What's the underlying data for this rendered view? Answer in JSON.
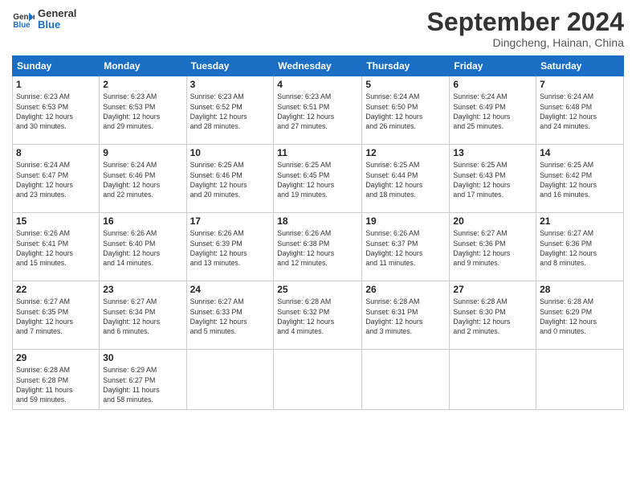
{
  "logo": {
    "line1": "General",
    "line2": "Blue"
  },
  "title": "September 2024",
  "location": "Dingcheng, Hainan, China",
  "weekdays": [
    "Sunday",
    "Monday",
    "Tuesday",
    "Wednesday",
    "Thursday",
    "Friday",
    "Saturday"
  ],
  "weeks": [
    [
      {
        "day": "1",
        "info": "Sunrise: 6:23 AM\nSunset: 6:53 PM\nDaylight: 12 hours\nand 30 minutes."
      },
      {
        "day": "2",
        "info": "Sunrise: 6:23 AM\nSunset: 6:53 PM\nDaylight: 12 hours\nand 29 minutes."
      },
      {
        "day": "3",
        "info": "Sunrise: 6:23 AM\nSunset: 6:52 PM\nDaylight: 12 hours\nand 28 minutes."
      },
      {
        "day": "4",
        "info": "Sunrise: 6:23 AM\nSunset: 6:51 PM\nDaylight: 12 hours\nand 27 minutes."
      },
      {
        "day": "5",
        "info": "Sunrise: 6:24 AM\nSunset: 6:50 PM\nDaylight: 12 hours\nand 26 minutes."
      },
      {
        "day": "6",
        "info": "Sunrise: 6:24 AM\nSunset: 6:49 PM\nDaylight: 12 hours\nand 25 minutes."
      },
      {
        "day": "7",
        "info": "Sunrise: 6:24 AM\nSunset: 6:48 PM\nDaylight: 12 hours\nand 24 minutes."
      }
    ],
    [
      {
        "day": "8",
        "info": "Sunrise: 6:24 AM\nSunset: 6:47 PM\nDaylight: 12 hours\nand 23 minutes."
      },
      {
        "day": "9",
        "info": "Sunrise: 6:24 AM\nSunset: 6:46 PM\nDaylight: 12 hours\nand 22 minutes."
      },
      {
        "day": "10",
        "info": "Sunrise: 6:25 AM\nSunset: 6:46 PM\nDaylight: 12 hours\nand 20 minutes."
      },
      {
        "day": "11",
        "info": "Sunrise: 6:25 AM\nSunset: 6:45 PM\nDaylight: 12 hours\nand 19 minutes."
      },
      {
        "day": "12",
        "info": "Sunrise: 6:25 AM\nSunset: 6:44 PM\nDaylight: 12 hours\nand 18 minutes."
      },
      {
        "day": "13",
        "info": "Sunrise: 6:25 AM\nSunset: 6:43 PM\nDaylight: 12 hours\nand 17 minutes."
      },
      {
        "day": "14",
        "info": "Sunrise: 6:25 AM\nSunset: 6:42 PM\nDaylight: 12 hours\nand 16 minutes."
      }
    ],
    [
      {
        "day": "15",
        "info": "Sunrise: 6:26 AM\nSunset: 6:41 PM\nDaylight: 12 hours\nand 15 minutes."
      },
      {
        "day": "16",
        "info": "Sunrise: 6:26 AM\nSunset: 6:40 PM\nDaylight: 12 hours\nand 14 minutes."
      },
      {
        "day": "17",
        "info": "Sunrise: 6:26 AM\nSunset: 6:39 PM\nDaylight: 12 hours\nand 13 minutes."
      },
      {
        "day": "18",
        "info": "Sunrise: 6:26 AM\nSunset: 6:38 PM\nDaylight: 12 hours\nand 12 minutes."
      },
      {
        "day": "19",
        "info": "Sunrise: 6:26 AM\nSunset: 6:37 PM\nDaylight: 12 hours\nand 11 minutes."
      },
      {
        "day": "20",
        "info": "Sunrise: 6:27 AM\nSunset: 6:36 PM\nDaylight: 12 hours\nand 9 minutes."
      },
      {
        "day": "21",
        "info": "Sunrise: 6:27 AM\nSunset: 6:36 PM\nDaylight: 12 hours\nand 8 minutes."
      }
    ],
    [
      {
        "day": "22",
        "info": "Sunrise: 6:27 AM\nSunset: 6:35 PM\nDaylight: 12 hours\nand 7 minutes."
      },
      {
        "day": "23",
        "info": "Sunrise: 6:27 AM\nSunset: 6:34 PM\nDaylight: 12 hours\nand 6 minutes."
      },
      {
        "day": "24",
        "info": "Sunrise: 6:27 AM\nSunset: 6:33 PM\nDaylight: 12 hours\nand 5 minutes."
      },
      {
        "day": "25",
        "info": "Sunrise: 6:28 AM\nSunset: 6:32 PM\nDaylight: 12 hours\nand 4 minutes."
      },
      {
        "day": "26",
        "info": "Sunrise: 6:28 AM\nSunset: 6:31 PM\nDaylight: 12 hours\nand 3 minutes."
      },
      {
        "day": "27",
        "info": "Sunrise: 6:28 AM\nSunset: 6:30 PM\nDaylight: 12 hours\nand 2 minutes."
      },
      {
        "day": "28",
        "info": "Sunrise: 6:28 AM\nSunset: 6:29 PM\nDaylight: 12 hours\nand 0 minutes."
      }
    ],
    [
      {
        "day": "29",
        "info": "Sunrise: 6:28 AM\nSunset: 6:28 PM\nDaylight: 11 hours\nand 59 minutes."
      },
      {
        "day": "30",
        "info": "Sunrise: 6:29 AM\nSunset: 6:27 PM\nDaylight: 11 hours\nand 58 minutes."
      },
      {
        "day": "",
        "info": ""
      },
      {
        "day": "",
        "info": ""
      },
      {
        "day": "",
        "info": ""
      },
      {
        "day": "",
        "info": ""
      },
      {
        "day": "",
        "info": ""
      }
    ]
  ]
}
